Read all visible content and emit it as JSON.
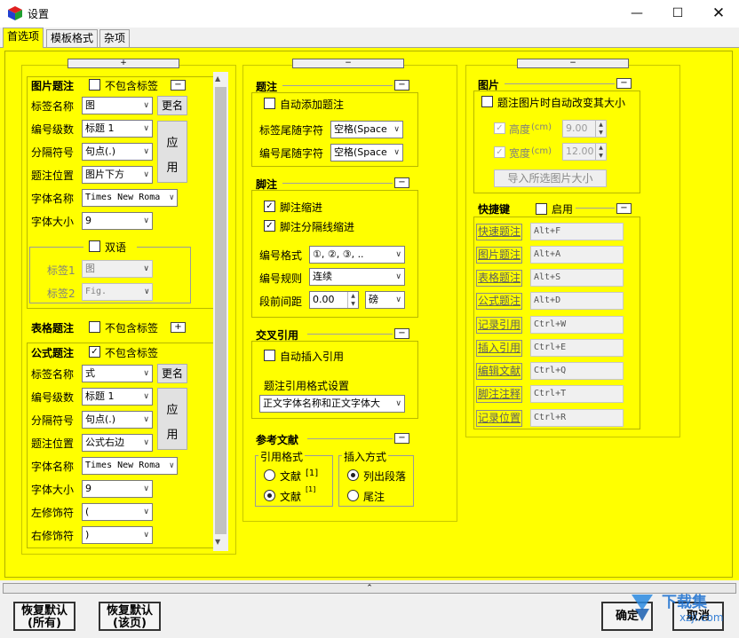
{
  "window": {
    "title": "设置"
  },
  "tabs": [
    "首选项",
    "模板格式",
    "杂项"
  ],
  "col_toggles": {
    "left": "+",
    "middle": "−",
    "right": "−"
  },
  "figure_caption": {
    "title": "图片题注",
    "exclude_label": "不包含标签",
    "collapse": "−",
    "rows": [
      {
        "label": "标签名称",
        "value": "图"
      },
      {
        "label": "编号级数",
        "value": "标题 1"
      },
      {
        "label": "分隔符号",
        "value": "句点(.)"
      },
      {
        "label": "题注位置",
        "value": "图片下方"
      },
      {
        "label": "字体名称",
        "value": "Times New Roma"
      },
      {
        "label": "字体大小",
        "value": "9"
      }
    ],
    "rename_button": "更名",
    "apply_button_1": "应",
    "apply_button_2": "用",
    "bilingual": {
      "label": "双语",
      "tag1_label": "标签1",
      "tag1_value": "图",
      "tag2_label": "标签2",
      "tag2_value": "Fig."
    }
  },
  "table_caption": {
    "title": "表格题注",
    "exclude_label": "不包含标签",
    "expand": "+"
  },
  "formula_caption": {
    "title": "公式题注",
    "exclude_label": "不包含标签",
    "exclude_checked": true,
    "rows": [
      {
        "label": "标签名称",
        "value": "式"
      },
      {
        "label": "编号级数",
        "value": "标题 1"
      },
      {
        "label": "分隔符号",
        "value": "句点(.)"
      },
      {
        "label": "题注位置",
        "value": "公式右边"
      },
      {
        "label": "字体名称",
        "value": "Times New Roma"
      },
      {
        "label": "字体大小",
        "value": "9"
      },
      {
        "label": "左修饰符",
        "value": "("
      },
      {
        "label": "右修饰符",
        "value": ")"
      }
    ],
    "rename_button": "更名",
    "apply_button_1": "应",
    "apply_button_2": "用"
  },
  "caption": {
    "title": "题注",
    "collapse": "−",
    "auto_add": "自动添加题注",
    "label_trailing": "标签尾随字符",
    "label_trailing_value": "空格(Space",
    "number_trailing": "编号尾随字符",
    "number_trailing_value": "空格(Space"
  },
  "footnote": {
    "title": "脚注",
    "collapse": "−",
    "indent": "脚注缩进",
    "separator_indent": "脚注分隔线缩进",
    "number_format": "编号格式",
    "number_format_value": "①, ②, ③, ..",
    "number_rule": "编号规则",
    "number_rule_value": "连续",
    "para_spacing": "段前间距",
    "para_spacing_value": "0.00",
    "unit": "磅"
  },
  "cross_ref": {
    "title": "交叉引用",
    "collapse": "−",
    "auto_insert": "自动插入引用",
    "format_label": "题注引用格式设置",
    "format_value": "正文字体名称和正文字体大"
  },
  "references": {
    "title": "参考文献",
    "collapse": "−",
    "cite_format": "引用格式",
    "cite_opt1": "文献",
    "cite_opt1_mark": "[1]",
    "cite_opt2": "文献",
    "cite_opt2_mark": "[1]",
    "insert_mode": "插入方式",
    "insert_opt1": "列出段落",
    "insert_opt2": "尾注"
  },
  "picture": {
    "title": "图片",
    "collapse": "−",
    "auto_resize": "题注图片时自动改变其大小",
    "height_label": "高度",
    "height_unit": "(cm)",
    "height_value": "9.00",
    "width_label": "宽度",
    "width_unit": "(cm)",
    "width_value": "12.00",
    "import_button": "导入所选图片大小"
  },
  "hotkeys": {
    "title": "快捷键",
    "enable": "启用",
    "collapse": "−",
    "items": [
      {
        "label": "快速题注",
        "key": "Alt+F"
      },
      {
        "label": "图片题注",
        "key": "Alt+A"
      },
      {
        "label": "表格题注",
        "key": "Alt+S"
      },
      {
        "label": "公式题注",
        "key": "Alt+D"
      },
      {
        "label": "记录引用",
        "key": "Ctrl+W"
      },
      {
        "label": "插入引用",
        "key": "Ctrl+E"
      },
      {
        "label": "编辑文献",
        "key": "Ctrl+Q"
      },
      {
        "label": "脚注注释",
        "key": "Ctrl+T"
      },
      {
        "label": "记录位置",
        "key": "Ctrl+R"
      }
    ]
  },
  "footer": {
    "splitter": "⌃",
    "restore_all_1": "恢复默认",
    "restore_all_2": "(所有)",
    "restore_page_1": "恢复默认",
    "restore_page_2": "(该页)",
    "ok": "确定",
    "cancel": "取消",
    "watermark_text": "下载集",
    "watermark_url": "xzji.com"
  }
}
